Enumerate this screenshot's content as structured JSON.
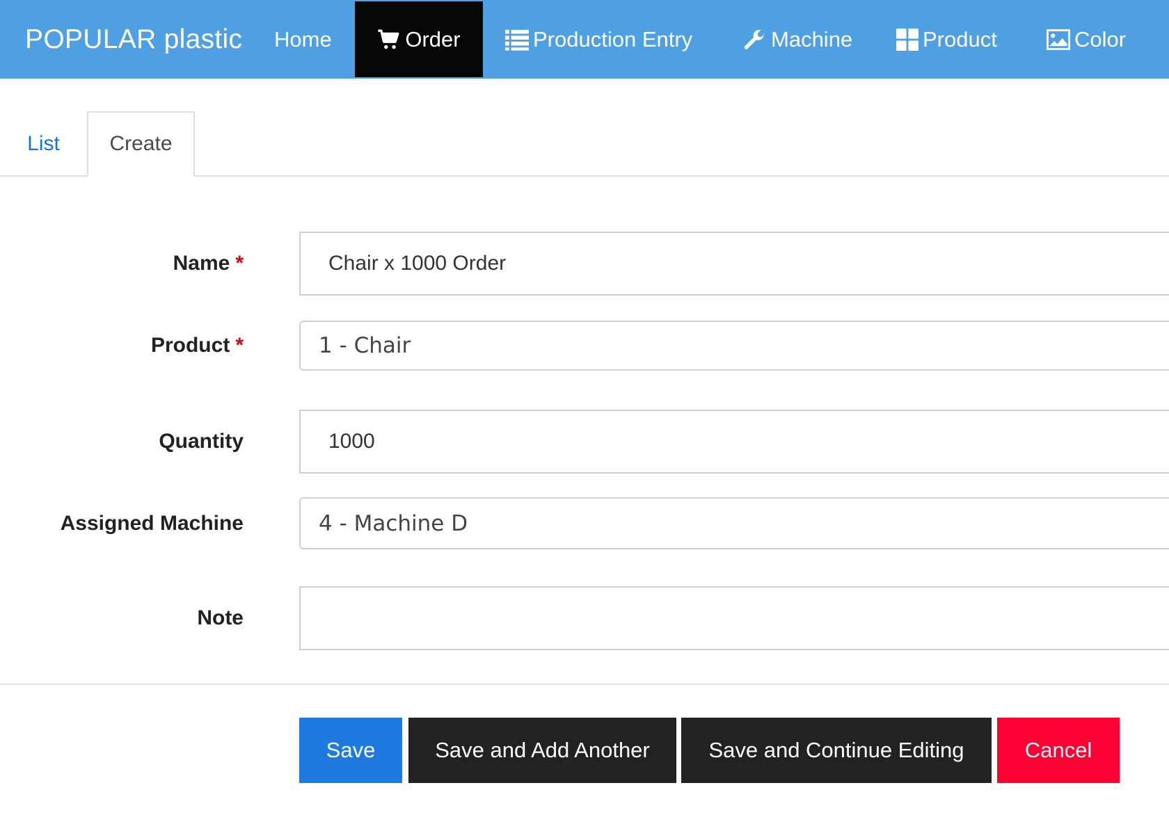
{
  "app": {
    "brand": "POPULAR plastic"
  },
  "nav": {
    "home": "Home",
    "order": "Order",
    "production_entry": "Production Entry",
    "machine": "Machine",
    "product": "Product",
    "color": "Color",
    "active": "Order",
    "icons": {
      "order": "cart-icon",
      "production_entry": "list-icon",
      "machine": "wrench-icon",
      "product": "grid-icon",
      "color": "image-icon"
    }
  },
  "tabs": {
    "list": "List",
    "create": "Create",
    "active": "Create"
  },
  "form": {
    "name": {
      "label": "Name",
      "required_mark": "*",
      "value": "Chair x 1000 Order"
    },
    "product": {
      "label": "Product",
      "required_mark": "*",
      "value": "1 - Chair"
    },
    "quantity": {
      "label": "Quantity",
      "value": "1000"
    },
    "assigned_machine": {
      "label": "Assigned Machine",
      "value": "4 - Machine D"
    },
    "note": {
      "label": "Note",
      "value": ""
    }
  },
  "buttons": {
    "save": "Save",
    "save_add_another": "Save and Add Another",
    "save_continue": "Save and Continue Editing",
    "cancel": "Cancel"
  },
  "colors": {
    "navbar": "#4f9fe3",
    "nav_active": "#070707",
    "link": "#1b74d3",
    "required": "#e00012",
    "save_button": "#1f7ae0",
    "dark_button": "#222222",
    "cancel_button": "#ff0033"
  }
}
